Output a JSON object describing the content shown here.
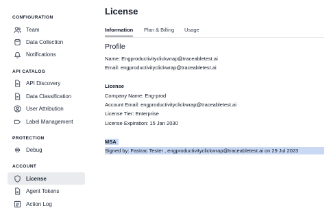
{
  "sidebar": {
    "sections": [
      {
        "title": "CONFIGURATION",
        "items": [
          {
            "label": "Team",
            "icon": "team-icon"
          },
          {
            "label": "Data Collection",
            "icon": "database-icon"
          },
          {
            "label": "Notifications",
            "icon": "bell-icon"
          }
        ]
      },
      {
        "title": "API CATALOG",
        "items": [
          {
            "label": "API Discovery",
            "icon": "document-icon"
          },
          {
            "label": "Data Classification",
            "icon": "document-icon"
          },
          {
            "label": "User Attribution",
            "icon": "user-circle-icon"
          },
          {
            "label": "Label Management",
            "icon": "tag-icon"
          }
        ]
      },
      {
        "title": "PROTECTION",
        "items": [
          {
            "label": "Debug",
            "icon": "gear-icon"
          }
        ]
      },
      {
        "title": "ACCOUNT",
        "items": [
          {
            "label": "License",
            "icon": "shield-icon",
            "active": true
          },
          {
            "label": "Agent Tokens",
            "icon": "document-icon"
          },
          {
            "label": "Action Log",
            "icon": "list-icon"
          }
        ]
      }
    ]
  },
  "main": {
    "title": "License",
    "tabs": [
      {
        "label": "Information",
        "active": true
      },
      {
        "label": "Plan & Billing"
      },
      {
        "label": "Usage"
      }
    ],
    "profile": {
      "heading": "Profile",
      "name_line": "Name: Engproductivityclickwrap@traceabletest.ai",
      "email_line": "Email: engproductivityclickwrap@traceabletest.ai"
    },
    "license": {
      "heading": "License",
      "company_line": "Company Name: Eng-prod",
      "account_email_line": "Account Email: engproductivityclickwrap@traceabletest.ai",
      "tier_line": "License Tier: Enterprise",
      "expiration_line": "License Expiration: 15 Jan 2030"
    },
    "msa": {
      "heading": "MSA",
      "signed_line": "Signed by: Fastrac Tester , engproductivityclickwrap@traceabletest.ai on 29 Jul 2023"
    }
  }
}
